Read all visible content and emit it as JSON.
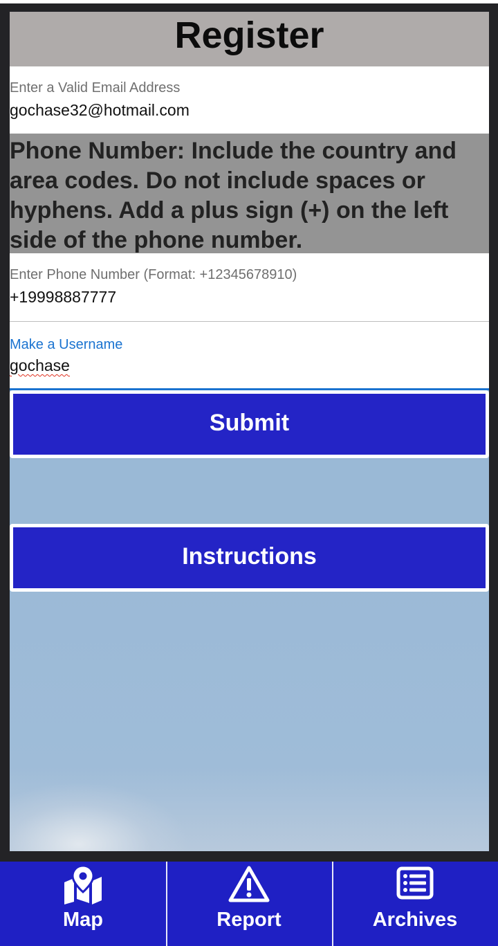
{
  "header": {
    "title": "Register"
  },
  "email": {
    "label": "Enter a Valid Email Address",
    "value": "gochase32@hotmail.com"
  },
  "phone_notice": {
    "text": "Phone Number: Include the country and area codes. Do not include spaces or hyphens. Add a plus sign (+) on the left side of the phone number."
  },
  "phone": {
    "label": "Enter Phone Number (Format: +12345678910)",
    "value": "+19998887777"
  },
  "username": {
    "label": "Make a Username",
    "value": "gochase"
  },
  "buttons": {
    "submit": "Submit",
    "instructions": "Instructions"
  },
  "nav": {
    "items": [
      {
        "label": "Map",
        "icon": "map-icon"
      },
      {
        "label": "Report",
        "icon": "warning-icon"
      },
      {
        "label": "Archives",
        "icon": "list-icon"
      }
    ]
  },
  "colors": {
    "accent": "#2424c6",
    "header_bg": "#afabaa",
    "notice_bg": "#949494",
    "focus": "#1a73d0"
  }
}
